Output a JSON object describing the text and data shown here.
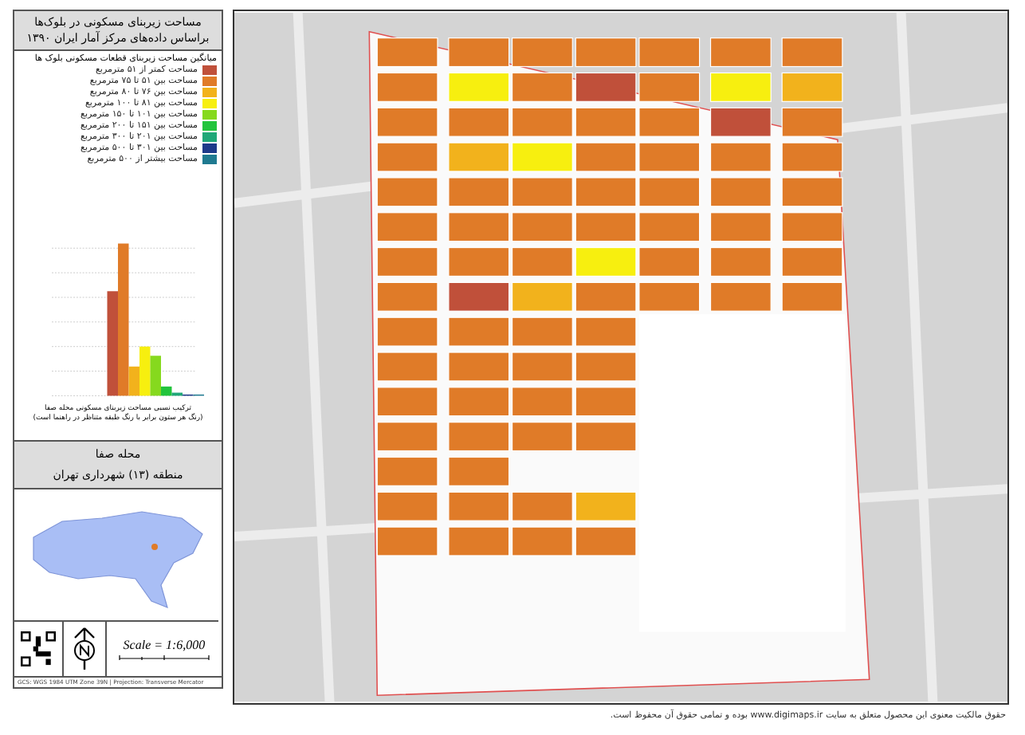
{
  "panel": {
    "title_lines": [
      "مساحت زیربنای مسکونی در بلوک‌ها",
      "براساس داده‌های مرکز آمار ایران ۱۳۹۰"
    ],
    "legend": {
      "heading": "میانگین مساحت زیربنای قطعات مسکونی بلوک ها",
      "items": [
        {
          "label": "مساحت کمتر از ۵۱ مترمربع",
          "color": "#c0503a"
        },
        {
          "label": "مساحت بین ۵۱ تا ۷۵ مترمربع",
          "color": "#e07b28"
        },
        {
          "label": "مساحت بین ۷۶ تا ۸۰ مترمربع",
          "color": "#f2b21c"
        },
        {
          "label": "مساحت بین ۸۱ تا ۱۰۰ مترمربع",
          "color": "#f7ef0f"
        },
        {
          "label": "مساحت بین ۱۰۱ تا ۱۵۰ مترمربع",
          "color": "#86d91e"
        },
        {
          "label": "مساحت بین ۱۵۱ تا ۲۰۰ مترمربع",
          "color": "#22c43c"
        },
        {
          "label": "مساحت بین ۲۰۱ تا ۳۰۰ مترمربع",
          "color": "#20a878"
        },
        {
          "label": "مساحت بین ۳۰۱ تا ۵۰۰ مترمربع",
          "color": "#1d3a8a"
        },
        {
          "label": "مساحت بیشتر از ۵۰۰ مترمربع",
          "color": "#1f7a90"
        }
      ]
    },
    "chart_caption_lines": [
      "ترکیب نسبی مساحت زیربنای مسکونی محله صفا",
      "(رنگ هر ستون برابر با رنگ طبقه متناظر در راهنما است)"
    ],
    "area": {
      "neighborhood": "محله صفا",
      "district": "منطقه (۱۳) شهرداری تهران"
    },
    "scale": "Scale = 1:6,000",
    "credit": "GCS: WGS 1984 UTM Zone 39N | Projection: Transverse Mercator"
  },
  "footer": "حقوق مالکیت معنوی این محصول متعلق به سایت www.digimaps.ir بوده و تمامی حقوق آن محفوظ است."
}
